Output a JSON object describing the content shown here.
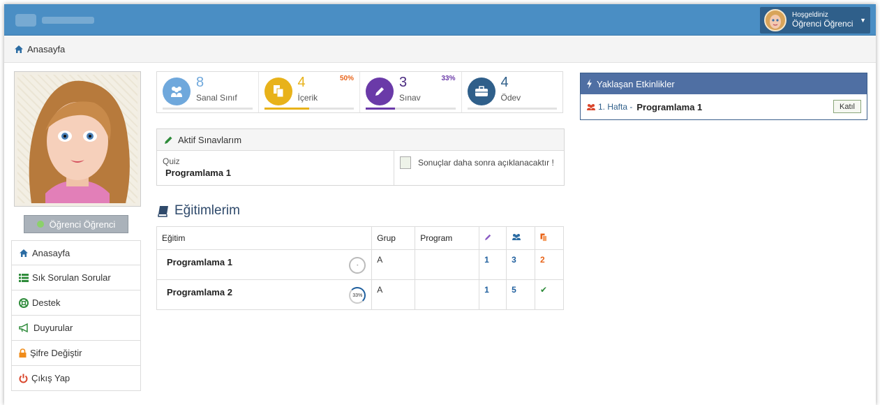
{
  "header": {
    "welcome": "Hoşgeldiniz",
    "user_name": "Öğrenci Öğrenci",
    "colors": {
      "topbar": "#4a8ec4",
      "user_box": "#2f5f8a"
    }
  },
  "breadcrumb": {
    "home": "Anasayfa"
  },
  "profile": {
    "status_name": "Öğrenci Öğrenci",
    "status_color": "#8bd16a"
  },
  "sidebar": {
    "items": [
      {
        "label": "Anasayfa",
        "icon": "home-icon"
      },
      {
        "label": "Sık Sorulan Sorular",
        "icon": "list-icon"
      },
      {
        "label": "Destek",
        "icon": "lifebuoy-icon"
      },
      {
        "label": "Duyurular",
        "icon": "megaphone-icon"
      },
      {
        "label": "Şifre Değiştir",
        "icon": "lock-icon"
      },
      {
        "label": "Çıkış Yap",
        "icon": "power-icon"
      }
    ]
  },
  "stats": [
    {
      "value": "8",
      "label": "Sanal Sınıf",
      "percent_text": "",
      "progress": 0,
      "color": "#6fa8dc",
      "icon": "users-icon"
    },
    {
      "value": "4",
      "label": "İçerik",
      "percent_text": "50%",
      "progress": 0.5,
      "color": "#e8b21a",
      "icon": "copy-icon"
    },
    {
      "value": "3",
      "label": "Sınav",
      "percent_text": "33%",
      "progress": 0.33,
      "color": "#6a3aa8",
      "icon": "pencil-icon"
    },
    {
      "value": "4",
      "label": "Ödev",
      "percent_text": "",
      "progress": 0,
      "color": "#2f5f8a",
      "icon": "briefcase-icon"
    }
  ],
  "active_exams": {
    "title": "Aktif Sınavlarım",
    "type": "Quiz",
    "name": "Programlama 1",
    "result_note": "Sonuçlar daha sonra açıklanacaktır !"
  },
  "trainings": {
    "title": "Eğitimlerim",
    "headers": {
      "course": "Eğitim",
      "group": "Grup",
      "program": "Program"
    },
    "rows": [
      {
        "name": "Programlama 1",
        "progress_text": "-",
        "group": "A",
        "program": "",
        "exams": "1",
        "classes": "3",
        "contents": "2"
      },
      {
        "name": "Programlama 2",
        "progress_text": "33%",
        "group": "A",
        "program": "",
        "exams": "1",
        "classes": "5",
        "contents": "✔"
      }
    ]
  },
  "events": {
    "title": "Yaklaşan Etkinlikler",
    "items": [
      {
        "week": "1. Hafta -",
        "name": "Programlama 1",
        "action": "Katıl"
      }
    ]
  }
}
